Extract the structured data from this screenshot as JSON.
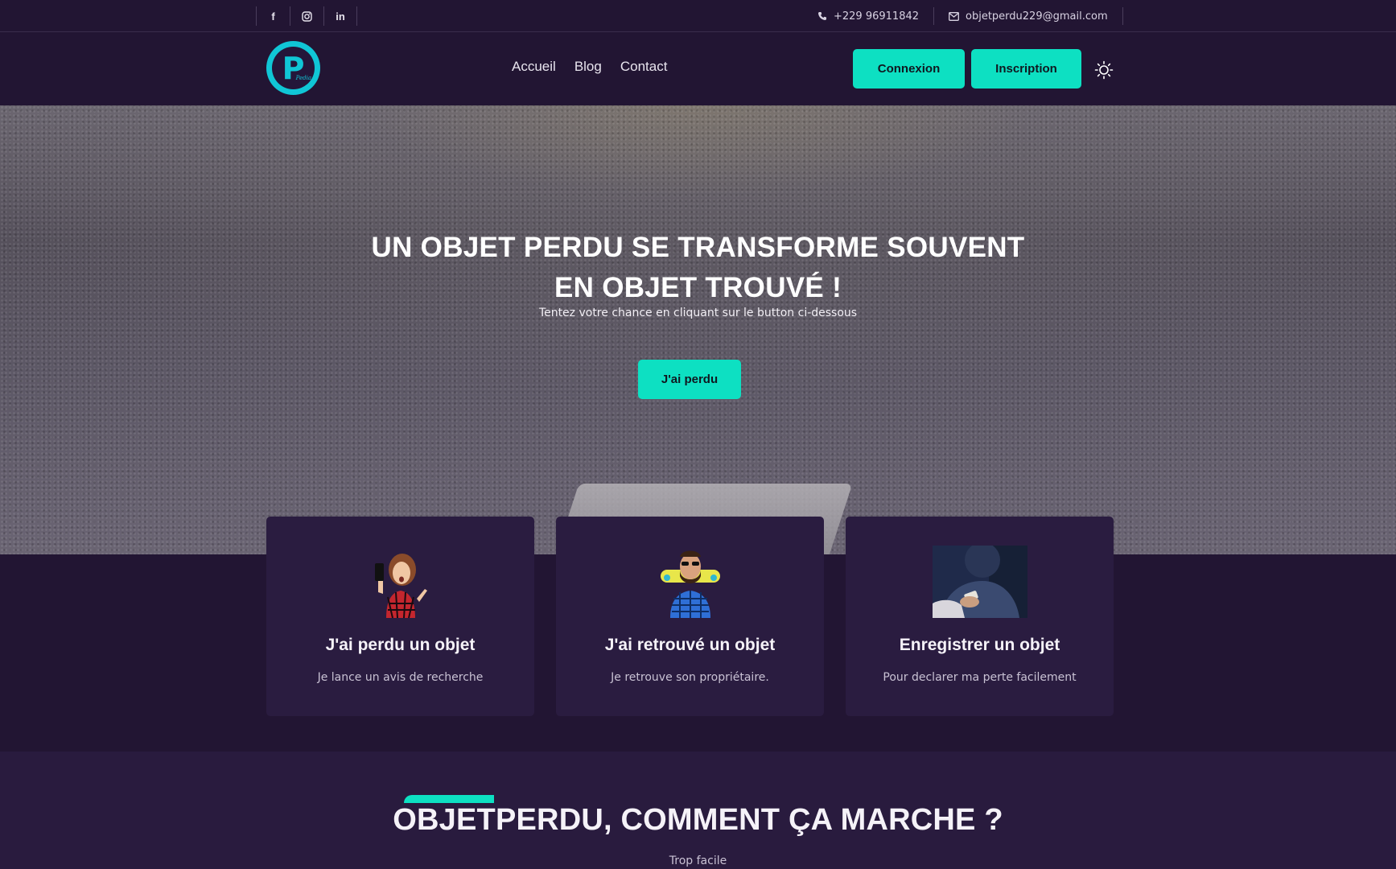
{
  "colors": {
    "accent": "#0de0c2",
    "background": "#221533",
    "card": "#2a1c40",
    "logo": "#10c6d6"
  },
  "topbar": {
    "social": [
      {
        "icon": "facebook-icon",
        "glyph": "f"
      },
      {
        "icon": "instagram-icon",
        "glyph": ""
      },
      {
        "icon": "linkedin-icon",
        "glyph": "in"
      }
    ],
    "phone": "+229 96911842",
    "email": "objetperdu229@gmail.com"
  },
  "nav": {
    "logo_letter": "P",
    "logo_tag": "Pedia",
    "menu": [
      "Accueil",
      "Blog",
      "Contact"
    ],
    "login_label": "Connexion",
    "signup_label": "Inscription",
    "theme_icon": "sun-icon"
  },
  "hero": {
    "title_line1": "UN OBJET PERDU SE TRANSFORME SOUVENT",
    "title_line2": "EN OBJET TROUVÉ !",
    "subtitle": "Tentez votre chance en cliquant sur le button ci-dessous",
    "cta_label": "J'ai perdu"
  },
  "cards": [
    {
      "title": "J'ai perdu un objet",
      "desc": "Je lance un avis de recherche",
      "image": "woman-with-phone"
    },
    {
      "title": "J'ai retrouvé un objet",
      "desc": "Je retrouve son propriétaire.",
      "image": "man-with-skateboard"
    },
    {
      "title": "Enregistrer un objet",
      "desc": "Pour declarer ma perte facilement",
      "image": "person-using-phone"
    }
  ],
  "how": {
    "title": "OBJETPERDU, COMMENT ÇA MARCHE ?",
    "subtitle": "Trop facile"
  }
}
